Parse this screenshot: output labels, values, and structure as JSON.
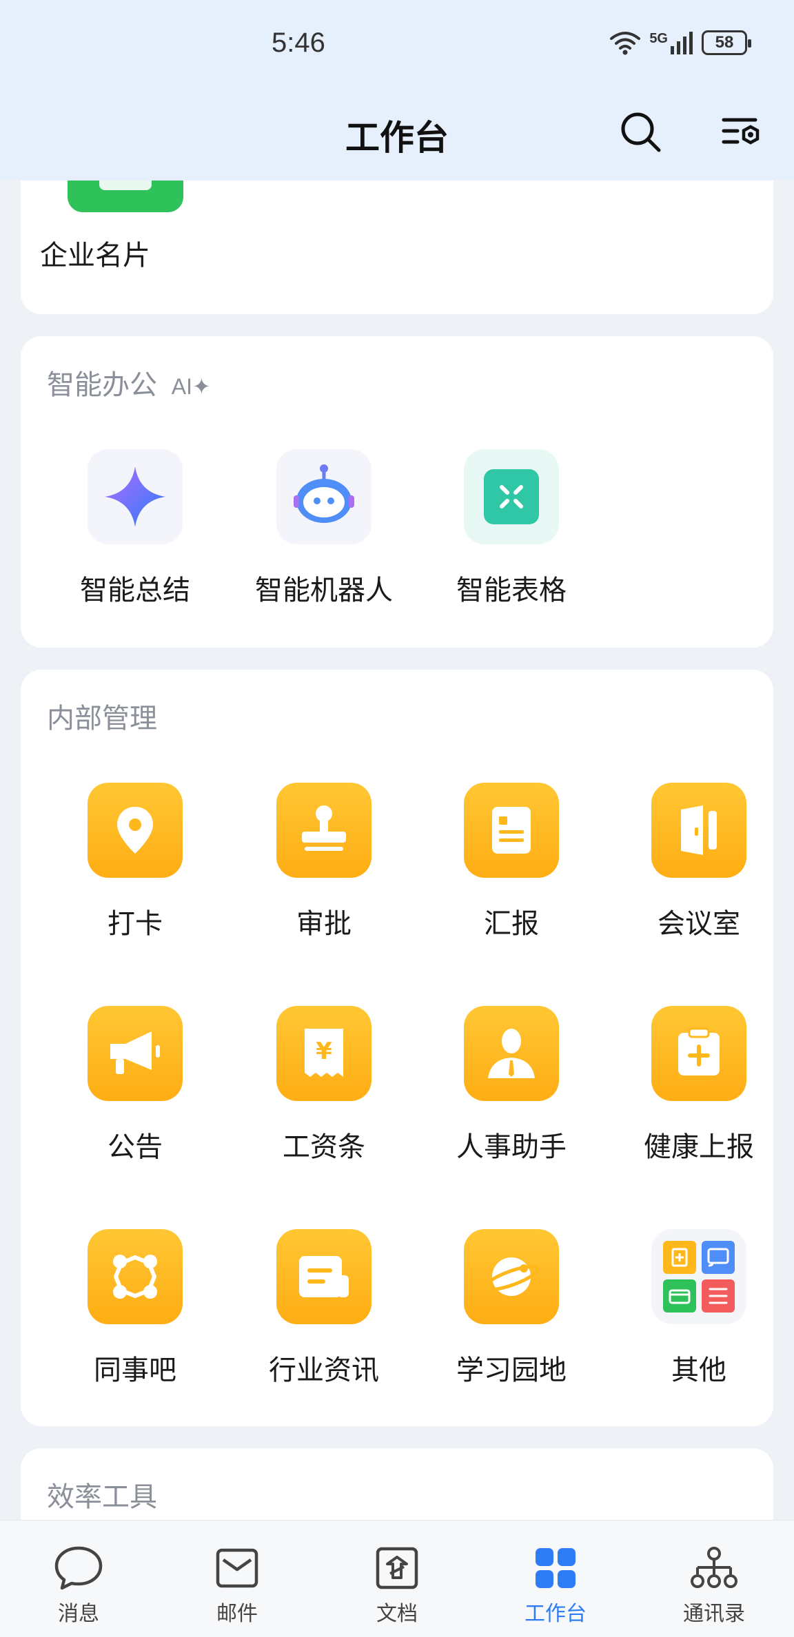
{
  "status": {
    "time": "5:46",
    "network": "5G",
    "battery": "58"
  },
  "header": {
    "title": "工作台"
  },
  "top_card": {
    "item_label": "企业名片"
  },
  "ai_section": {
    "title": "智能办公",
    "badge": "AI✦",
    "items": [
      {
        "label": "智能总结",
        "icon": "sparkle-icon"
      },
      {
        "label": "智能机器人",
        "icon": "robot-icon"
      },
      {
        "label": "智能表格",
        "icon": "spreadsheet-icon"
      }
    ]
  },
  "internal_section": {
    "title": "内部管理",
    "items": [
      {
        "label": "打卡",
        "icon": "location-pin-icon"
      },
      {
        "label": "审批",
        "icon": "stamp-icon"
      },
      {
        "label": "汇报",
        "icon": "report-icon"
      },
      {
        "label": "会议室",
        "icon": "door-icon"
      },
      {
        "label": "公告",
        "icon": "megaphone-icon"
      },
      {
        "label": "工资条",
        "icon": "payslip-icon"
      },
      {
        "label": "人事助手",
        "icon": "person-icon"
      },
      {
        "label": "健康上报",
        "icon": "health-clipboard-icon"
      },
      {
        "label": "同事吧",
        "icon": "network-icon"
      },
      {
        "label": "行业资讯",
        "icon": "news-icon"
      },
      {
        "label": "学习园地",
        "icon": "planet-icon"
      },
      {
        "label": "其他",
        "icon": "app-grid-icon"
      }
    ]
  },
  "efficiency_section": {
    "title": "效率工具"
  },
  "tabbar": {
    "tabs": [
      {
        "label": "消息",
        "icon": "chat-icon"
      },
      {
        "label": "邮件",
        "icon": "mail-icon"
      },
      {
        "label": "文档",
        "icon": "document-icon"
      },
      {
        "label": "工作台",
        "icon": "workbench-icon",
        "active": true
      },
      {
        "label": "通讯录",
        "icon": "contacts-icon"
      }
    ]
  },
  "colors": {
    "accent": "#2e7cf6",
    "tile_orange": "#ffb81c",
    "header_bg": "#e6effc"
  }
}
